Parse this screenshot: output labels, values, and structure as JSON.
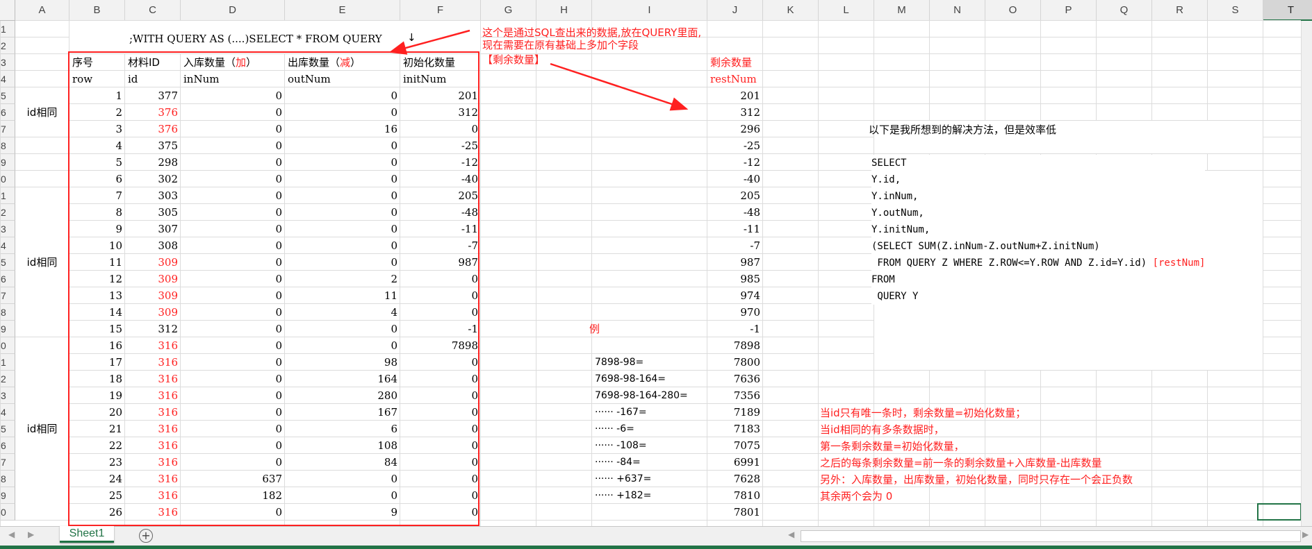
{
  "columns": [
    "A",
    "B",
    "C",
    "D",
    "E",
    "F",
    "G",
    "H",
    "I",
    "J",
    "K",
    "L",
    "M",
    "N",
    "O",
    "P",
    "Q",
    "R",
    "S",
    "T"
  ],
  "row_numbers": [
    "1",
    "2",
    "3",
    "4",
    "5",
    "6",
    "7",
    "8",
    "9",
    "0",
    "1",
    "2",
    "3",
    "4",
    "5",
    "6",
    "7",
    "8",
    "9",
    "0",
    "1",
    "2",
    "3",
    "4",
    "5",
    "6",
    "7",
    "8",
    "9",
    "0"
  ],
  "query_title": ";WITH QUERY AS (....)SELECT * FROM QUERY",
  "down_arrow": "↓",
  "headers_cn": {
    "row": "序号",
    "id": "材料ID",
    "in_main": "入库数量（",
    "in_red": "加",
    "in_end": "）",
    "out_main": "出库数量（",
    "out_red": "减",
    "out_end": "）",
    "init": "初始化数量",
    "rest": "剩余数量",
    "rest_note": "【剩余数量】"
  },
  "headers_en": {
    "row": "row",
    "id": "id",
    "in": "inNum",
    "out": "outNum",
    "init": "initNum",
    "rest": "restNum"
  },
  "group_labels": [
    "id相同",
    "id相同",
    "id相同"
  ],
  "rows": [
    {
      "row": "1",
      "id": "377",
      "in": "0",
      "out": "0",
      "init": "201",
      "rest": "201",
      "red": false,
      "calc": ""
    },
    {
      "row": "2",
      "id": "376",
      "in": "0",
      "out": "0",
      "init": "312",
      "rest": "312",
      "red": true,
      "calc": ""
    },
    {
      "row": "3",
      "id": "376",
      "in": "0",
      "out": "16",
      "init": "0",
      "rest": "296",
      "red": true,
      "calc": ""
    },
    {
      "row": "4",
      "id": "375",
      "in": "0",
      "out": "0",
      "init": "-25",
      "rest": "-25",
      "red": false,
      "calc": ""
    },
    {
      "row": "5",
      "id": "298",
      "in": "0",
      "out": "0",
      "init": "-12",
      "rest": "-12",
      "red": false,
      "calc": ""
    },
    {
      "row": "6",
      "id": "302",
      "in": "0",
      "out": "0",
      "init": "-40",
      "rest": "-40",
      "red": false,
      "calc": ""
    },
    {
      "row": "7",
      "id": "303",
      "in": "0",
      "out": "0",
      "init": "205",
      "rest": "205",
      "red": false,
      "calc": ""
    },
    {
      "row": "8",
      "id": "305",
      "in": "0",
      "out": "0",
      "init": "-48",
      "rest": "-48",
      "red": false,
      "calc": ""
    },
    {
      "row": "9",
      "id": "307",
      "in": "0",
      "out": "0",
      "init": "-11",
      "rest": "-11",
      "red": false,
      "calc": ""
    },
    {
      "row": "10",
      "id": "308",
      "in": "0",
      "out": "0",
      "init": "-7",
      "rest": "-7",
      "red": false,
      "calc": ""
    },
    {
      "row": "11",
      "id": "309",
      "in": "0",
      "out": "0",
      "init": "987",
      "rest": "987",
      "red": true,
      "calc": ""
    },
    {
      "row": "12",
      "id": "309",
      "in": "0",
      "out": "2",
      "init": "0",
      "rest": "985",
      "red": true,
      "calc": ""
    },
    {
      "row": "13",
      "id": "309",
      "in": "0",
      "out": "11",
      "init": "0",
      "rest": "974",
      "red": true,
      "calc": ""
    },
    {
      "row": "14",
      "id": "309",
      "in": "0",
      "out": "4",
      "init": "0",
      "rest": "970",
      "red": true,
      "calc": ""
    },
    {
      "row": "15",
      "id": "312",
      "in": "0",
      "out": "0",
      "init": "-1",
      "rest": "-1",
      "red": false,
      "calc": ""
    },
    {
      "row": "16",
      "id": "316",
      "in": "0",
      "out": "0",
      "init": "7898",
      "rest": "7898",
      "red": true,
      "calc": ""
    },
    {
      "row": "17",
      "id": "316",
      "in": "0",
      "out": "98",
      "init": "0",
      "rest": "7800",
      "red": true,
      "calc": "7898-98="
    },
    {
      "row": "18",
      "id": "316",
      "in": "0",
      "out": "164",
      "init": "0",
      "rest": "7636",
      "red": true,
      "calc": "7698-98-164="
    },
    {
      "row": "19",
      "id": "316",
      "in": "0",
      "out": "280",
      "init": "0",
      "rest": "7356",
      "red": true,
      "calc": "7698-98-164-280="
    },
    {
      "row": "20",
      "id": "316",
      "in": "0",
      "out": "167",
      "init": "0",
      "rest": "7189",
      "red": true,
      "calc": "······ -167="
    },
    {
      "row": "21",
      "id": "316",
      "in": "0",
      "out": "6",
      "init": "0",
      "rest": "7183",
      "red": true,
      "calc": "······ -6="
    },
    {
      "row": "22",
      "id": "316",
      "in": "0",
      "out": "108",
      "init": "0",
      "rest": "7075",
      "red": true,
      "calc": "······ -108="
    },
    {
      "row": "23",
      "id": "316",
      "in": "0",
      "out": "84",
      "init": "0",
      "rest": "6991",
      "red": true,
      "calc": "······ -84="
    },
    {
      "row": "24",
      "id": "316",
      "in": "637",
      "out": "0",
      "init": "0",
      "rest": "7628",
      "red": true,
      "calc": "······ +637="
    },
    {
      "row": "25",
      "id": "316",
      "in": "182",
      "out": "0",
      "init": "0",
      "rest": "7810",
      "red": true,
      "calc": "······ +182="
    },
    {
      "row": "26",
      "id": "316",
      "in": "0",
      "out": "9",
      "init": "0",
      "rest": "7801",
      "red": true,
      "calc": ""
    }
  ],
  "example_label": "例",
  "note_top": [
    "这个是通过SQL查出来的数据,放在QUERY里面,",
    "现在需要在原有基础上多加个字段"
  ],
  "solution_title": "以下是我所想到的解决方法，但是效率低",
  "sql_lines": [
    "SELECT",
    "Y.id,",
    "Y.inNum,",
    "Y.outNum,",
    "Y.initNum,",
    "(SELECT SUM(Z.inNum-Z.outNum+Z.initNum)",
    " FROM QUERY Z WHERE Z.ROW<=Y.ROW AND Z.id=Y.id) ",
    "FROM",
    " QUERY Y"
  ],
  "sql_rest_alias": "[restNum]",
  "rules": [
    "当id只有唯一条时，剩余数量=初始化数量；",
    "当id相同的有多条数据时，",
    "第一条剩余数量=初始化数量，",
    "之后的每条剩余数量=前一条的剩余数量+入库数量-出库数量",
    "另外：入库数量，出库数量，初始化数量，同时只存在一个会正负数",
    "其余两个会为 0"
  ],
  "sheet_tab": "Sheet1",
  "add_sheet": "+",
  "nav_prev": "◀",
  "nav_next": "▶",
  "scroll_left": "◀",
  "scroll_right": "▶",
  "colors": {
    "accent_green": "#217346",
    "annotation_red": "#ff2020"
  }
}
